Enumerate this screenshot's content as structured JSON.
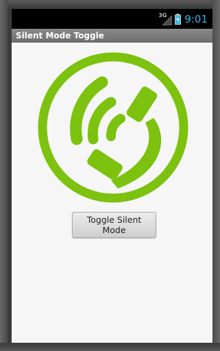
{
  "status_bar": {
    "network_label": "3G",
    "time": "9:01",
    "signal_icon": "signal-icon",
    "battery_icon": "battery-icon",
    "clock_color": "#33b5e5"
  },
  "app": {
    "title": "Silent Mode Toggle"
  },
  "main": {
    "graphic_icon": "phone-ring-icon",
    "graphic_color": "#7cc20e",
    "toggle_button_label": "Toggle Silent Mode"
  }
}
